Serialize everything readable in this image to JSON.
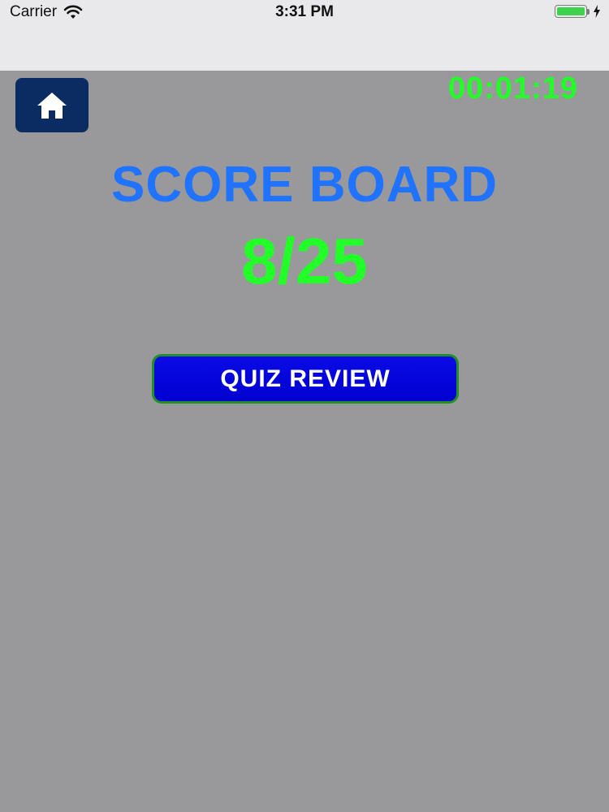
{
  "status_bar": {
    "carrier": "Carrier",
    "time": "3:31 PM",
    "battery_level": 1.0,
    "charging": true,
    "wifi_icon": "wifi-icon",
    "battery_color": "#3fd24e"
  },
  "header": {
    "home_icon": "home-icon",
    "timer": "00:01:19"
  },
  "score": {
    "title": "SCORE BOARD",
    "value": "8/25"
  },
  "actions": {
    "quiz_review_label": "QUIZ REVIEW"
  },
  "colors": {
    "background": "#99989b",
    "title_blue": "#1f73ff",
    "score_green": "#22ff28",
    "button_blue": "#0000d0",
    "button_border": "#1f8f2a",
    "home_button": "#0b2c63"
  }
}
